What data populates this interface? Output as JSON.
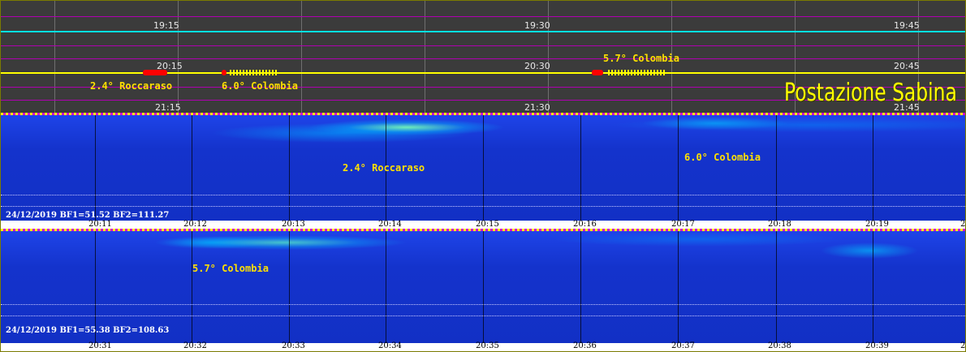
{
  "brand": "Postazione Sabina",
  "top_panel": {
    "times_row1": [
      "19:15",
      "19:30",
      "19:45"
    ],
    "times_row2": [
      "20:15",
      "20:30",
      "20:45"
    ],
    "times_row3": [
      "21:15",
      "21:30",
      "21:45"
    ],
    "events": [
      "5.7° Colombia",
      "2.4° Roccaraso",
      "6.0° Colombia"
    ],
    "colors": {
      "trace1": "#00e0e0",
      "trace2": "#ffff00",
      "event_marker": "#ff0000"
    }
  },
  "spectrogram1": {
    "info": "24/12/2019 BF1=51.52 BF2=111.27",
    "labels": [
      "2.4° Roccaraso",
      "6.0° Colombia"
    ],
    "ticks": [
      "20:11",
      "20:12",
      "20:13",
      "20:14",
      "20:15",
      "20:16",
      "20:17",
      "20:18",
      "20:19",
      "2"
    ]
  },
  "spectrogram2": {
    "info": "24/12/2019 BF1=55.38 BF2=108.63",
    "labels": [
      "5.7° Colombia"
    ],
    "ticks": [
      "20:31",
      "20:32",
      "20:33",
      "20:34",
      "20:35",
      "20:36",
      "20:37",
      "20:38",
      "20:39",
      "2"
    ]
  }
}
